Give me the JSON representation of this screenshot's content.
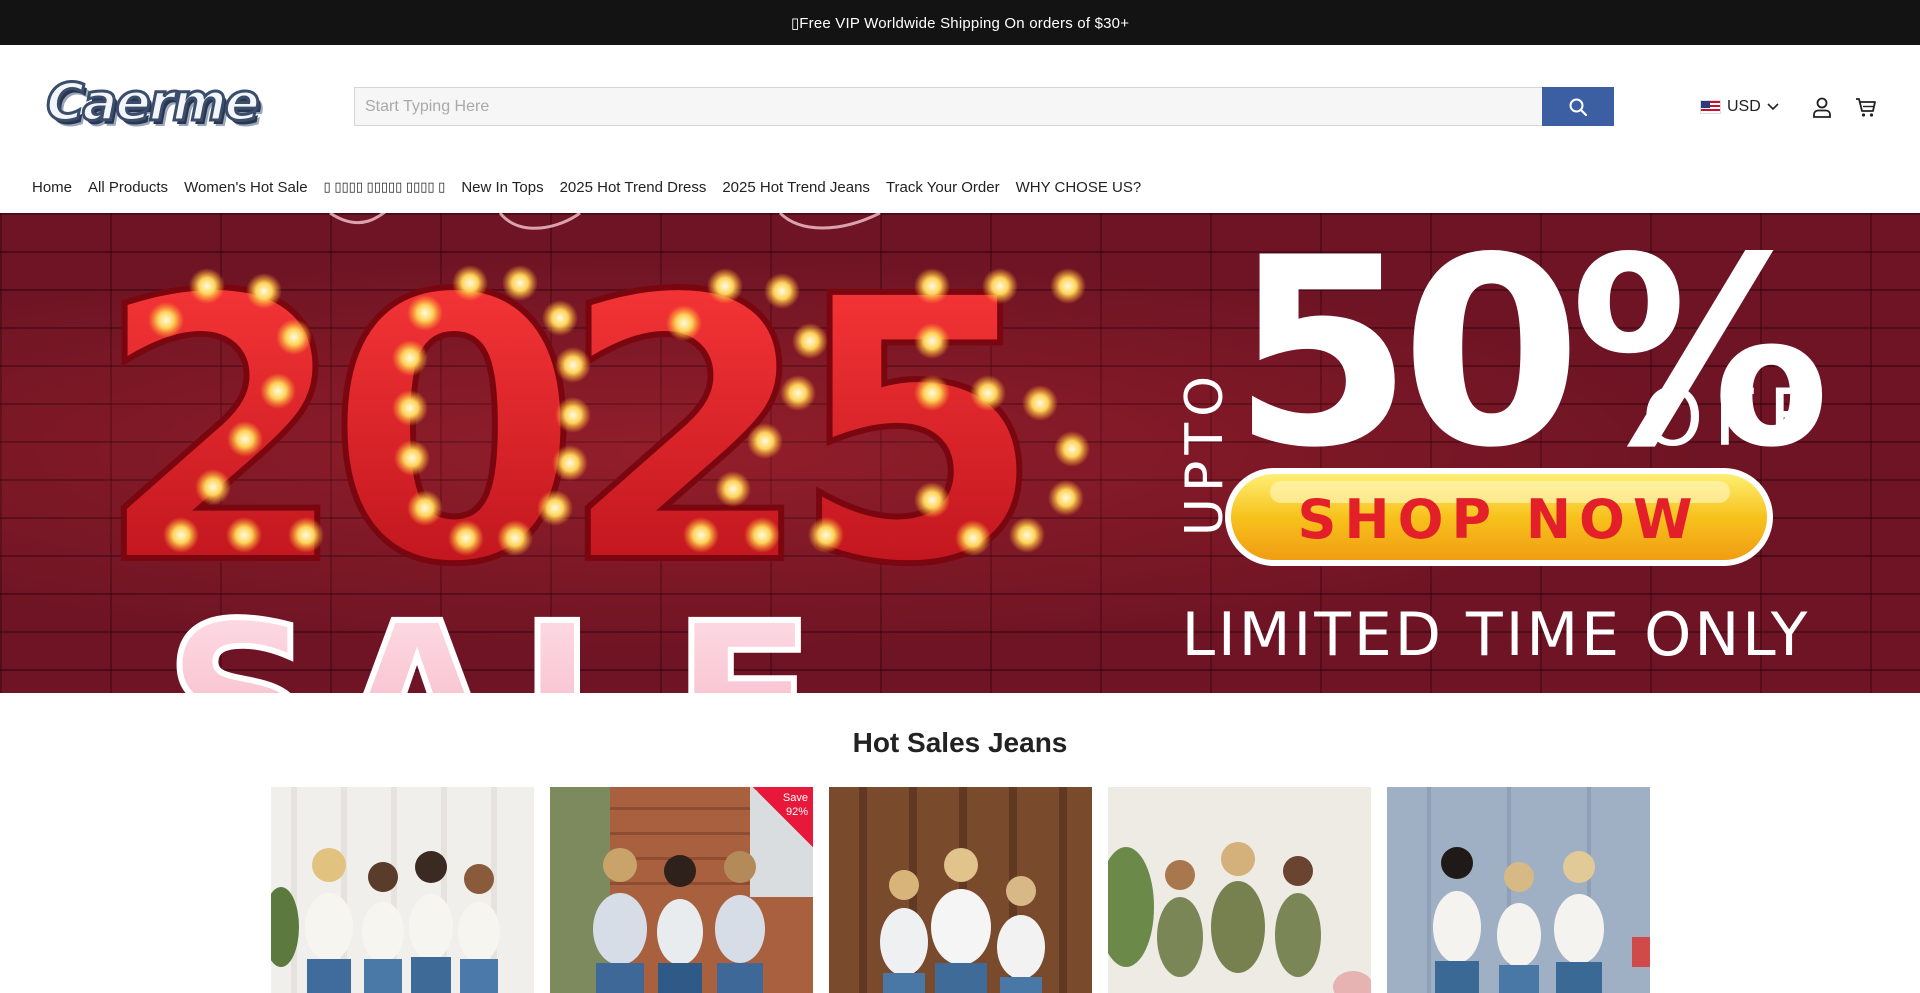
{
  "announcement": {
    "text": "▯Free VIP Worldwide Shipping On orders of $30+"
  },
  "header": {
    "logo_text": "Caerme",
    "search": {
      "placeholder": "Start Typing Here",
      "value": ""
    },
    "currency": {
      "label": "USD",
      "flag": "us-flag-icon"
    },
    "icons": [
      "search-icon",
      "chevron-down-icon",
      "user-icon",
      "cart-icon"
    ]
  },
  "nav": {
    "items": [
      {
        "label": "Home"
      },
      {
        "label": "All Products"
      },
      {
        "label": "Women's Hot Sale"
      },
      {
        "label": "▯ ▯▯▯▯ ▯▯▯▯▯ ▯▯▯▯ ▯"
      },
      {
        "label": "New In Tops"
      },
      {
        "label": "2025 Hot Trend Dress"
      },
      {
        "label": "2025 Hot Trend Jeans"
      },
      {
        "label": "Track Your Order"
      },
      {
        "label": "WHY CHOSE US?"
      }
    ]
  },
  "hero": {
    "year": "2025",
    "sale_word": "SALE",
    "upto": "UPTO",
    "percent": "50%",
    "off": "OFF",
    "cta": "SHOP NOW",
    "tagline": "LIMITED TIME ONLY"
  },
  "section": {
    "title": "Hot Sales Jeans"
  },
  "products": [
    {
      "badge": ""
    },
    {
      "badge_line1": "Save",
      "badge_line2": "92%"
    },
    {
      "badge": ""
    },
    {
      "badge": ""
    },
    {
      "badge": ""
    }
  ],
  "colors": {
    "announcement_bg": "#131313",
    "search_button": "#3c5fa3",
    "hero_bg": "#6e1424",
    "hero_digits": "#d81c24",
    "cta_yellow": "#f7c21c",
    "cta_text": "#e3202a",
    "save_badge": "#e8183a"
  }
}
